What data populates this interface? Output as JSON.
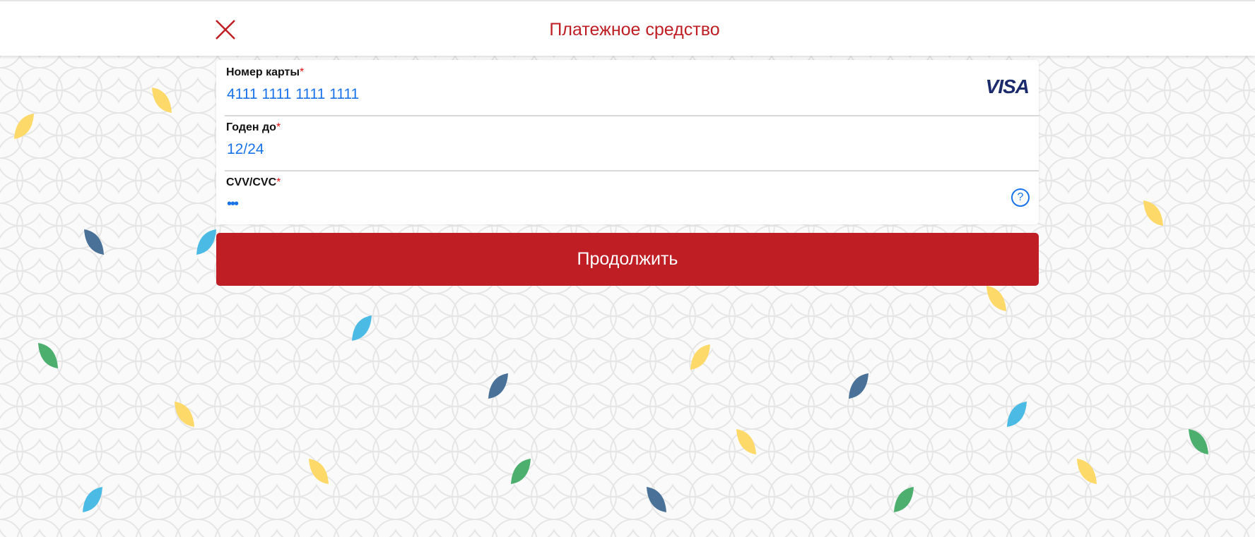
{
  "header": {
    "title": "Платежное средство",
    "close_icon": "close-icon"
  },
  "form": {
    "card_number": {
      "label": "Номер карты",
      "required_mark": "*",
      "value": "4111 1111 1111 1111",
      "brand": "VISA"
    },
    "expiry": {
      "label": "Годен до",
      "required_mark": "*",
      "value": "12/24"
    },
    "cvv": {
      "label": "CVV/CVC",
      "required_mark": "*",
      "value": "•••",
      "help_icon": "question-circle-icon",
      "help_glyph": "?"
    },
    "submit_label": "Продолжить"
  },
  "colors": {
    "accent": "#be1e24",
    "value_text": "#1a73e8",
    "visa": "#1a2a6c"
  },
  "background": {
    "petal_colors": [
      "#fdd96a",
      "#4a7299",
      "#4bbbe6",
      "#4caf6e"
    ]
  }
}
